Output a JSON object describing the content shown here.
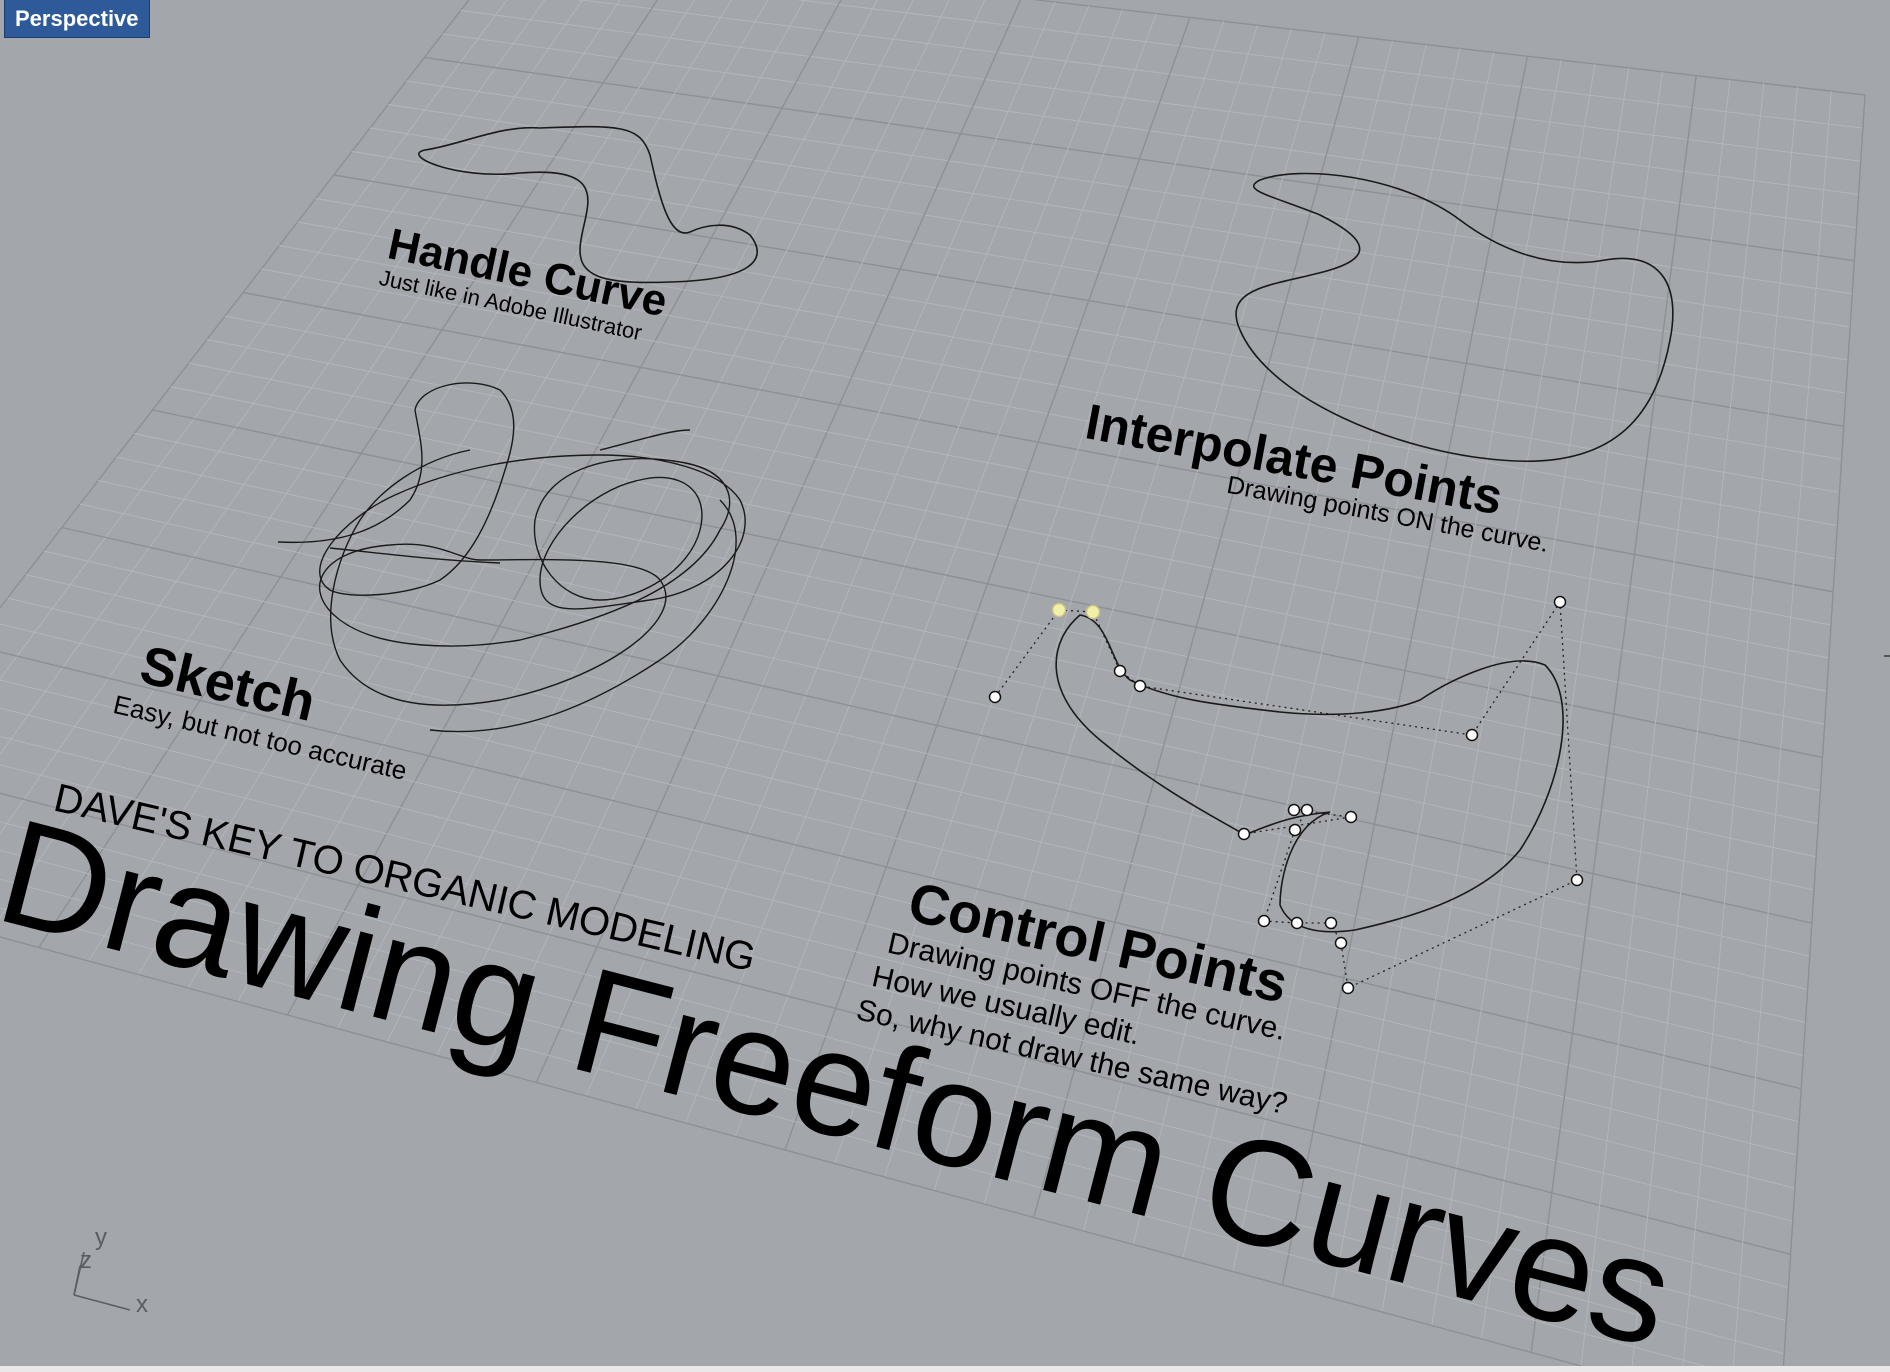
{
  "viewport": {
    "tab_label": "Perspective"
  },
  "sections": {
    "handle_curve": {
      "title": "Handle Curve",
      "subtitle": "Just like in Adobe Illustrator"
    },
    "interpolate_points": {
      "title": "Interpolate Points",
      "subtitle": "Drawing points ON the curve."
    },
    "sketch": {
      "title": "Sketch",
      "subtitle": "Easy, but not too accurate"
    },
    "control_points": {
      "title": "Control Points",
      "line1": "Drawing points OFF the curve.",
      "line2": "How we usually edit.",
      "line3": "So, why not draw the same way?"
    }
  },
  "heading": {
    "kicker": "DAVE'S KEY TO ORGANIC MODELING",
    "main": "Drawing Freeform Curves"
  },
  "axes": {
    "x": "x",
    "y": "y",
    "z": "z"
  },
  "colors": {
    "background": "#a3a7ac",
    "grid_minor": "#b3b7bc",
    "grid_major": "#8d9196",
    "tab": "#2e5a99",
    "selected_point": "#f2f0a8"
  }
}
